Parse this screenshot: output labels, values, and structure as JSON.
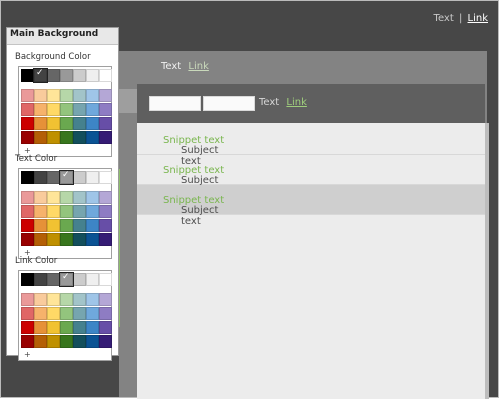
{
  "header": {
    "text": "Text",
    "separator": "|",
    "link": "Link"
  },
  "panel": {
    "text": "Text",
    "link": "Link"
  },
  "toolbar": {
    "text": "Text",
    "link": "Link",
    "input1_value": "",
    "input2_value": ""
  },
  "list": {
    "rows": [
      {
        "subject": "Subject text",
        "snippet": "Snippet text"
      },
      {
        "subject": "Subject text",
        "snippet": "Snippet text"
      },
      {
        "subject": "Subject text",
        "snippet": "Snippet text"
      }
    ]
  },
  "sidebar": {
    "title": "Main Background",
    "sections": [
      {
        "label": "Background Color",
        "add_label": "+"
      },
      {
        "label": "Text Color",
        "add_label": "+"
      },
      {
        "label": "Link Color",
        "add_label": "+"
      }
    ]
  },
  "colors": {
    "accent_green": "#7ab64f",
    "frame_bg": "#474747",
    "content_bg": "#ececec",
    "selected_row": "#cfcfcf",
    "top_row": [
      "#000000",
      "#434343",
      "#666666",
      "#999999",
      "#cccccc",
      "#efefef",
      "#ffffff"
    ],
    "grid_rows": [
      [
        "#ea9999",
        "#f9cb9c",
        "#ffe599",
        "#b6d7a8",
        "#a2c4c9",
        "#9fc5e8",
        "#b4a7d6"
      ],
      [
        "#e06666",
        "#f6b26b",
        "#ffd966",
        "#93c47d",
        "#76a5af",
        "#6fa8dc",
        "#8e7cc3"
      ],
      [
        "#cc0000",
        "#e69138",
        "#f1c232",
        "#6aa84f",
        "#45818e",
        "#3d85c6",
        "#674ea7"
      ],
      [
        "#990000",
        "#b45f06",
        "#bf9000",
        "#38761d",
        "#134f5c",
        "#0b5394",
        "#351c75"
      ]
    ],
    "selected_indices": [
      1,
      3,
      3
    ]
  }
}
